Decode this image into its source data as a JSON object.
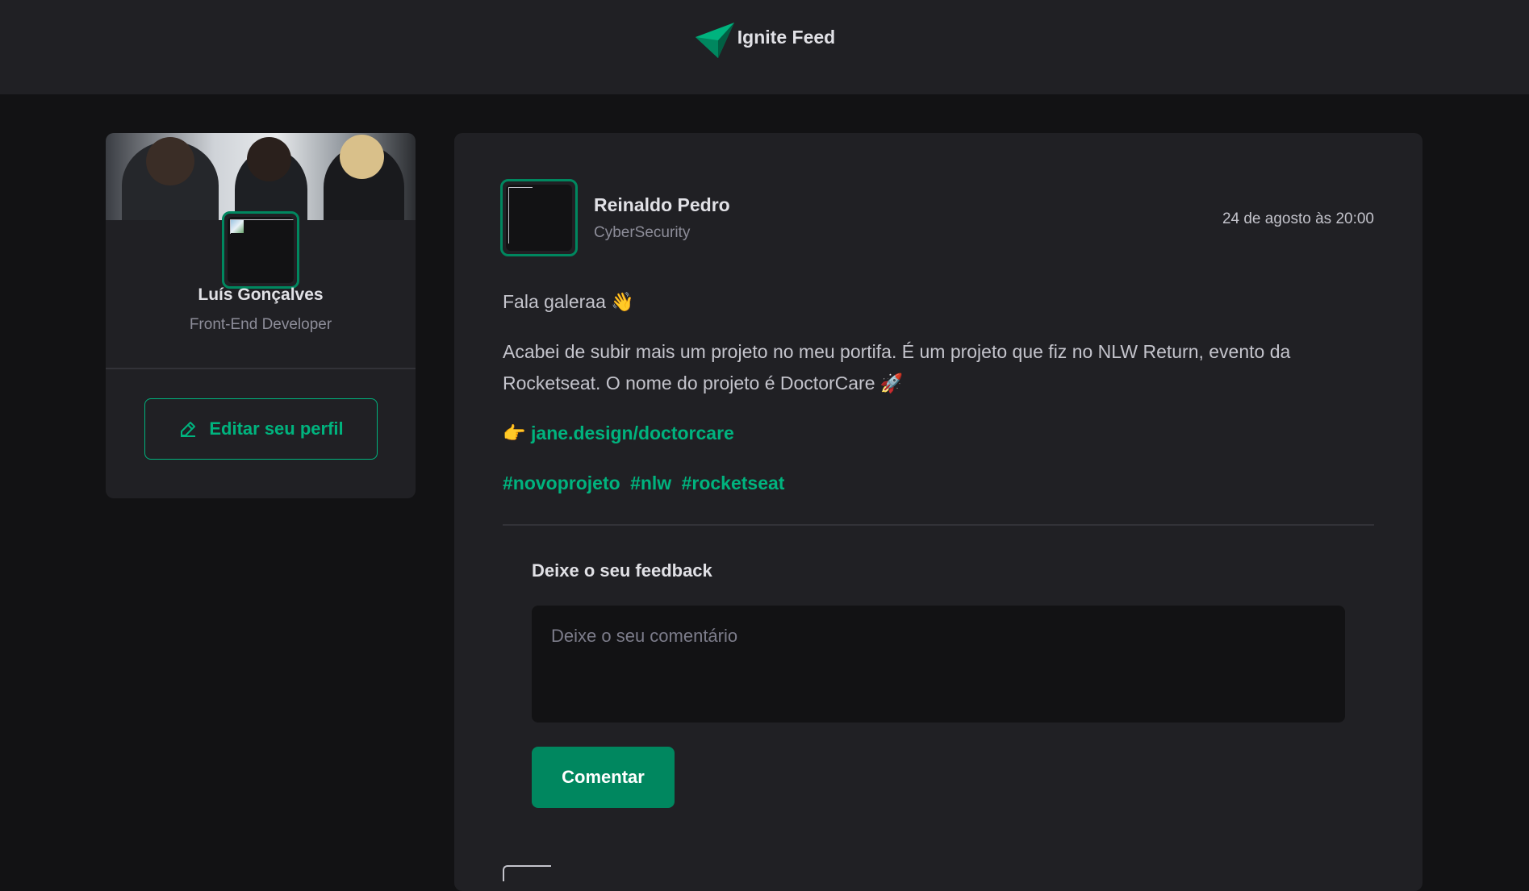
{
  "header": {
    "title": "Ignite Feed",
    "logo_icon": "ignite-logo-icon"
  },
  "colors": {
    "accent": "#00875f",
    "accent_light": "#00b37e",
    "background": "#121214",
    "surface": "#202024"
  },
  "profile": {
    "name": "Luís Gonçalves",
    "role": "Front-End Developer",
    "edit_button": "Editar seu perfil",
    "edit_icon": "pencil-icon"
  },
  "post": {
    "author": {
      "name": "Reinaldo Pedro",
      "role": "CyberSecurity"
    },
    "time": "24 de agosto às 20:00",
    "greeting": "Fala galeraa 👋",
    "body": "Acabei de subir mais um projeto no meu portifa. É um projeto que fiz no NLW Return, evento da Rocketseat. O nome do projeto é DoctorCare 🚀",
    "link_prefix": "👉 ",
    "link": "jane.design/doctorcare",
    "tags": [
      "#novoprojeto",
      "#nlw",
      "#rocketseat"
    ]
  },
  "feedback": {
    "title": "Deixe o seu feedback",
    "placeholder": "Deixe o seu comentário",
    "submit": "Comentar"
  }
}
